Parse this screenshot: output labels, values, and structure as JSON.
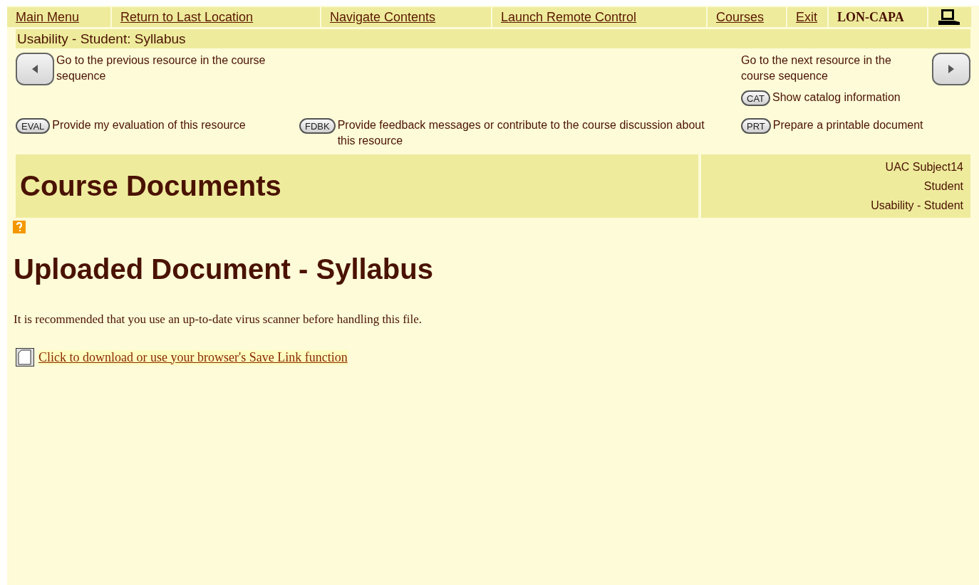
{
  "menu": {
    "items": [
      {
        "label": "Main Menu"
      },
      {
        "label": "Return to Last Location"
      },
      {
        "label": "Navigate Contents"
      },
      {
        "label": "Launch Remote Control"
      },
      {
        "label": "Courses"
      },
      {
        "label": "Exit"
      }
    ],
    "brand": "LON-CAPA"
  },
  "breadcrumb": "Usability - Student: Syllabus",
  "nav": {
    "previous": {
      "text": "Go to the previous resource in the course sequence"
    },
    "next": {
      "text": "Go to the next resource in the course sequence"
    },
    "catalog": {
      "badge": "CAT",
      "text": "Show catalog information"
    },
    "evaluation": {
      "badge": "EVAL",
      "text": "Provide my evaluation of this resource"
    },
    "feedback": {
      "badge": "FDBK",
      "text": "Provide feedback messages or contribute to the course discussion about this resource"
    },
    "print": {
      "badge": "PRT",
      "text": "Prepare a printable document"
    }
  },
  "header": {
    "title": "Course Documents",
    "info": [
      "UAC Subject14",
      "Student",
      "Usability - Student"
    ]
  },
  "content": {
    "heading": "Uploaded Document - Syllabus",
    "notice": "It is recommended that you use an up-to-date virus scanner before handling this file.",
    "download_link": "Click to download or use your browser's Save Link function"
  }
}
